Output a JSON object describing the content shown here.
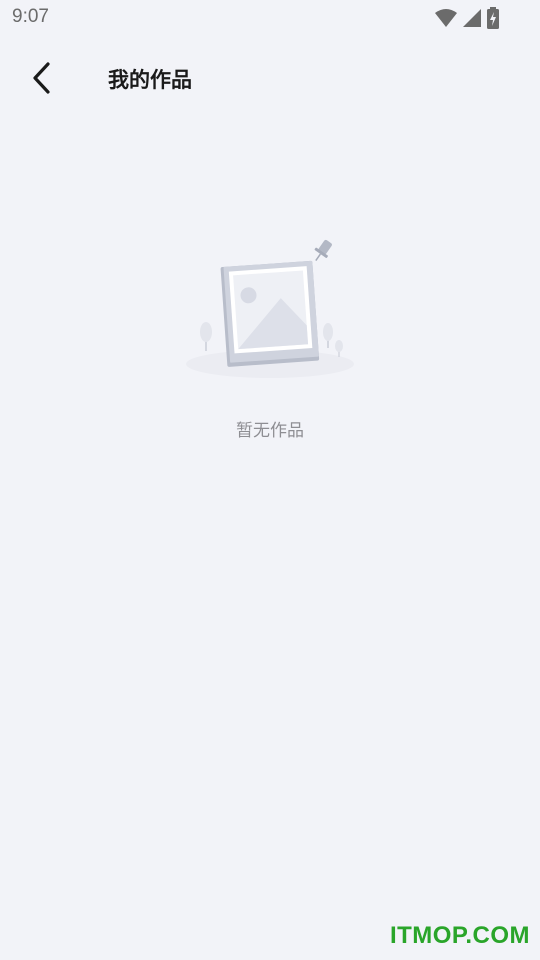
{
  "status_bar": {
    "time": "9:07",
    "icons": [
      "wifi-icon",
      "cellular-signal-icon",
      "battery-charging-icon"
    ]
  },
  "header": {
    "back_icon": "chevron-left-icon",
    "title": "我的作品"
  },
  "empty_state": {
    "illustration": "empty-photo-frame-illustration",
    "message": "暂无作品"
  },
  "watermark": {
    "text": "ITMOP.COM",
    "color": "#2aa52a"
  },
  "colors": {
    "background": "#f2f3f8",
    "title": "#1a1a1a",
    "muted_text": "#8e8e93"
  }
}
